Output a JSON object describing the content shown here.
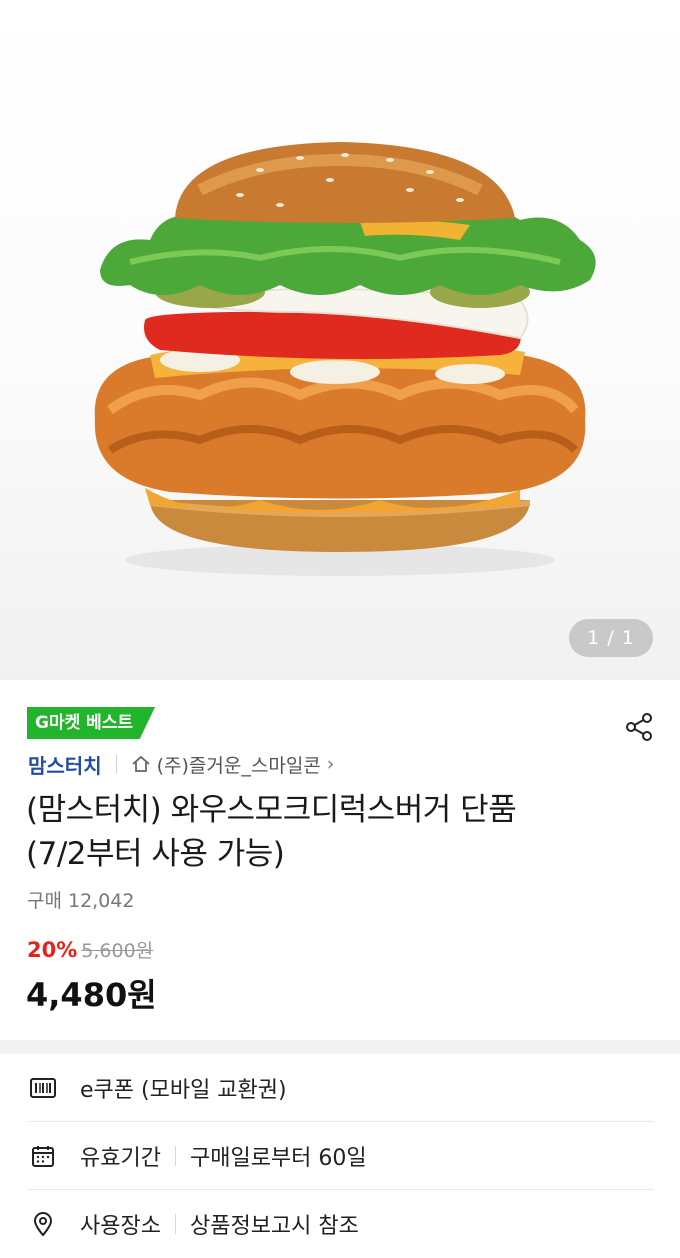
{
  "gallery": {
    "pager": "1 / 1"
  },
  "product": {
    "badge": "G마켓 베스트",
    "brand": "맘스터치",
    "seller": "(주)즐거운_스마일콘",
    "title_line1": "(맘스터치) 와우스모크디럭스버거 단품",
    "title_line2": "(7/2부터 사용 가능)",
    "purchase_count": "구매 12,042",
    "discount": "20%",
    "original_price": "5,600원",
    "price": "4,480원"
  },
  "details": [
    {
      "icon": "barcode-icon",
      "label": "e쿠폰 (모바일 교환권)",
      "value": ""
    },
    {
      "icon": "calendar-icon",
      "label": "유효기간",
      "value": "구매일로부터 60일"
    },
    {
      "icon": "location-pin-icon",
      "label": "사용장소",
      "value": "상품정보고시 참조"
    }
  ],
  "colors": {
    "badge": "#22b52c",
    "brand": "#1f4ea8",
    "discount": "#e1251b"
  }
}
